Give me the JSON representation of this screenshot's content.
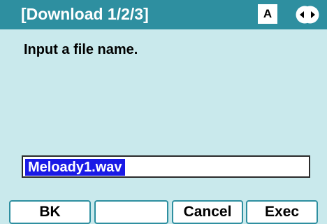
{
  "header": {
    "title": "[Download 1/2/3]",
    "input_mode": "A",
    "nav_icon": "left-right-arrows-icon"
  },
  "main": {
    "prompt": "Input a file name.",
    "filename_value": "Meloady1.wav"
  },
  "softkeys": [
    {
      "label": "BK"
    },
    {
      "label": ""
    },
    {
      "label": "Cancel"
    },
    {
      "label": "Exec"
    }
  ],
  "colors": {
    "title_bar": "#2e8fa0",
    "background": "#c9e9ec",
    "selection": "#1a1ae6",
    "softkey_border": "#2e8fa0"
  }
}
